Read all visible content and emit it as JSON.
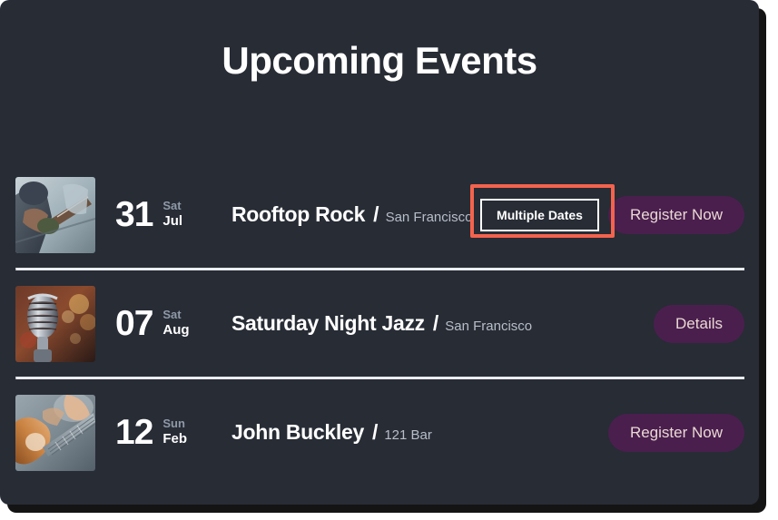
{
  "card": {
    "background_color": "#272c35",
    "title": "Upcoming Events"
  },
  "annotation": {
    "color": "#f4634e",
    "target": "Multiple Dates"
  },
  "theme": {
    "accent_purple": "#4a1f4e",
    "pill_text": "#e9d8d3",
    "muted_text": "#9099a8",
    "venue_text": "#b8bec8",
    "divider": "#e9ecef"
  },
  "events": [
    {
      "day": "31",
      "weekday": "Sat",
      "month": "Jul",
      "name": "Rooftop Rock",
      "separator": "/",
      "venue": "San Francisco",
      "thumbnail": "bass-guitarist-photo",
      "secondary_action": "Multiple Dates",
      "primary_action": "Register Now"
    },
    {
      "day": "07",
      "weekday": "Sat",
      "month": "Aug",
      "name": "Saturday Night Jazz",
      "separator": "/",
      "venue": "San Francisco",
      "thumbnail": "vintage-microphone-photo",
      "secondary_action": null,
      "primary_action": "Details"
    },
    {
      "day": "12",
      "weekday": "Sun",
      "month": "Feb",
      "name": "John Buckley",
      "separator": "/",
      "venue": "121 Bar",
      "thumbnail": "acoustic-guitar-photo",
      "secondary_action": null,
      "primary_action": "Register Now"
    }
  ]
}
